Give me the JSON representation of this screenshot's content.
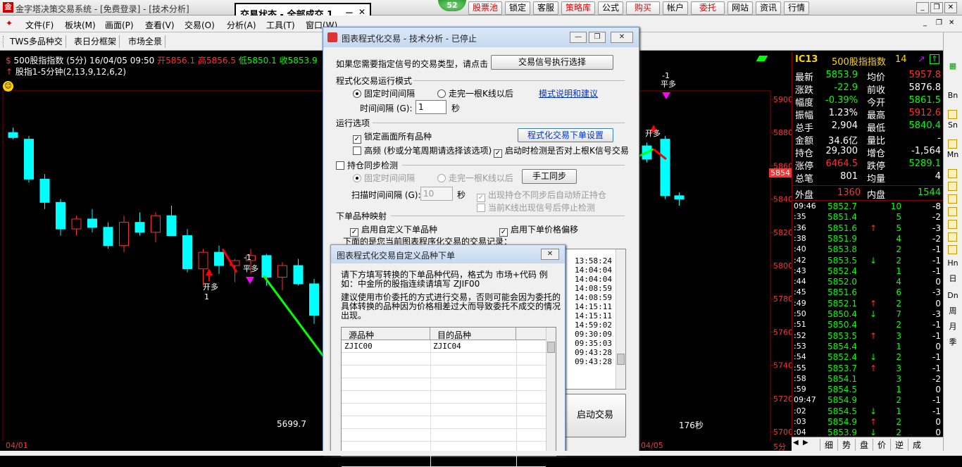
{
  "titlebar": {
    "title": "金字塔决策交易系统 - [免费登录] - [技术分析]",
    "badge": "52",
    "buttons": [
      {
        "label": "股票池",
        "red": true
      },
      {
        "label": "锁定",
        "red": false
      },
      {
        "label": "客服",
        "red": false
      },
      {
        "label": "策略库",
        "red": true
      },
      {
        "label": "公式",
        "red": false
      },
      {
        "label": "购买",
        "red": true
      },
      {
        "label": "帐户",
        "red": false
      },
      {
        "label": "委托",
        "red": true
      },
      {
        "label": "网站",
        "red": false
      },
      {
        "label": "资讯",
        "red": false
      },
      {
        "label": "行情",
        "red": false
      }
    ]
  },
  "trade_state": {
    "title": "交易状态 - 全部成交 1",
    "pin": "ᅳ",
    "close": "✕"
  },
  "menubar": {
    "items": [
      "文件(F)",
      "板块(M)",
      "画面(P)",
      "查看(V)",
      "交易(O)",
      "分析(A)",
      "工具(T)",
      "窗口(W)"
    ]
  },
  "toolbar": {
    "items": [
      "TWS多品种交",
      "表日分框架",
      "市场全景"
    ]
  },
  "chart": {
    "ticker_prefix": "500股指指数 (5分) 16/04/05 09:50",
    "open_label": "开5856.1",
    "high_label": "高5856.5",
    "low_label": "低5850.1",
    "close_label": "收5853.9",
    "indicator": "股指1-5分钟(2,13,9,12,6,2)",
    "y_ticks": [
      "5900",
      "5880",
      "5860",
      "5840",
      "5820",
      "5800",
      "5780",
      "5760",
      "5740",
      "5720",
      "5700"
    ],
    "current_price_tag": "5854",
    "low_annot": "5699.7",
    "x_left": "04/01",
    "x_right": "04/05",
    "timer": "176秒",
    "period": "5分",
    "signal_labels": [
      "开多",
      "开多",
      "平多",
      "-1",
      "1"
    ],
    "colors": {
      "up": "#ff3030",
      "down": "#00ffff",
      "signal_red": "#ff0000",
      "signal_green": "#00ff00",
      "magenta": "#ff00ff"
    }
  },
  "chart_data": {
    "type": "candlestick",
    "ylim": [
      5700,
      5900
    ],
    "candles": [
      {
        "o": 5880,
        "h": 5883,
        "l": 5876,
        "c": 5877
      },
      {
        "o": 5876,
        "h": 5878,
        "l": 5850,
        "c": 5852
      },
      {
        "o": 5852,
        "h": 5855,
        "l": 5834,
        "c": 5838
      },
      {
        "o": 5838,
        "h": 5840,
        "l": 5818,
        "c": 5822
      },
      {
        "o": 5822,
        "h": 5830,
        "l": 5818,
        "c": 5828
      },
      {
        "o": 5828,
        "h": 5834,
        "l": 5820,
        "c": 5823
      },
      {
        "o": 5823,
        "h": 5826,
        "l": 5810,
        "c": 5812
      },
      {
        "o": 5812,
        "h": 5830,
        "l": 5808,
        "c": 5826
      },
      {
        "o": 5826,
        "h": 5832,
        "l": 5818,
        "c": 5820
      },
      {
        "o": 5820,
        "h": 5832,
        "l": 5814,
        "c": 5830
      },
      {
        "o": 5830,
        "h": 5836,
        "l": 5818,
        "c": 5818
      },
      {
        "o": 5818,
        "h": 5822,
        "l": 5796,
        "c": 5798
      },
      {
        "o": 5798,
        "h": 5810,
        "l": 5788,
        "c": 5808
      },
      {
        "o": 5808,
        "h": 5812,
        "l": 5795,
        "c": 5800
      },
      {
        "o": 5800,
        "h": 5804,
        "l": 5790,
        "c": 5803
      },
      {
        "o": 5803,
        "h": 5810,
        "l": 5795,
        "c": 5806
      },
      {
        "o": 5806,
        "h": 5807,
        "l": 5788,
        "c": 5793
      },
      {
        "o": 5793,
        "h": 5802,
        "l": 5785,
        "c": 5800
      },
      {
        "o": 5800,
        "h": 5804,
        "l": 5788,
        "c": 5789
      },
      {
        "o": 5789,
        "h": 5792,
        "l": 5765,
        "c": 5770
      },
      {
        "o": 5770,
        "h": 5784,
        "l": 5760,
        "c": 5775
      },
      {
        "o": 5775,
        "h": 5780,
        "l": 5748,
        "c": 5750
      },
      {
        "o": 5750,
        "h": 5752,
        "l": 5712,
        "c": 5716
      },
      {
        "o": 5716,
        "h": 5738,
        "l": 5700,
        "c": 5734
      }
    ],
    "right_candles": [
      {
        "o": 5872,
        "h": 5874,
        "l": 5862,
        "c": 5864
      },
      {
        "o": 5876,
        "h": 5878,
        "l": 5840,
        "c": 5842
      },
      {
        "o": 5842,
        "h": 5844,
        "l": 5836,
        "c": 5840
      }
    ]
  },
  "quote": {
    "code": "IC13",
    "name": "500股指指数",
    "num": "14",
    "rows": [
      {
        "l1": "最新",
        "v1": "5853.9",
        "c1": "#00ff00",
        "l2": "均价",
        "v2": "5957.8",
        "c2": "#ff3030"
      },
      {
        "l1": "涨跌",
        "v1": "-22.9",
        "c1": "#00ff00",
        "l2": "前收",
        "v2": "5876.8",
        "c2": "#ffffff"
      },
      {
        "l1": "幅度",
        "v1": "-0.39%",
        "c1": "#00ff00",
        "l2": "今开",
        "v2": "5861.5",
        "c2": "#00ff00"
      },
      {
        "l1": "振幅",
        "v1": "1.23%",
        "c1": "#ffffff",
        "l2": "最高",
        "v2": "5912.6",
        "c2": "#ff3030"
      },
      {
        "l1": "总手",
        "v1": "2,904",
        "c1": "#ffffff",
        "l2": "最低",
        "v2": "5840.4",
        "c2": "#00ff00"
      },
      {
        "l1": "金额",
        "v1": "34.6亿",
        "c1": "#ffffff",
        "l2": "量比",
        "v2": "-",
        "c2": "#ffffff"
      },
      {
        "l1": "持仓",
        "v1": "29,300",
        "c1": "#ffffff",
        "l2": "增仓",
        "v2": "-1,564",
        "c2": "#ffffff"
      },
      {
        "l1": "涨停",
        "v1": "6464.5",
        "c1": "#ff3030",
        "l2": "跌停",
        "v2": "5289.1",
        "c2": "#00ff00"
      },
      {
        "l1": "总笔",
        "v1": "801",
        "c1": "#ffffff",
        "l2": "均量",
        "v2": "4",
        "c2": "#ffffff"
      }
    ],
    "outer_label": "外盘",
    "outer_value": "1360",
    "inner_label": "内盘",
    "inner_value": "1544",
    "ticks": [
      {
        "t": "09:46",
        "p": "5852.7",
        "a": "",
        "v": "10",
        "d": "-8"
      },
      {
        "t": ":35",
        "p": "5851.4",
        "a": "",
        "v": "5",
        "d": "-2"
      },
      {
        "t": ":36",
        "p": "5851.6",
        "a": "↑",
        "v": "5",
        "d": "-3"
      },
      {
        "t": ":38",
        "p": "5851.9",
        "a": "",
        "v": "4",
        "d": "-2"
      },
      {
        "t": ":40",
        "p": "5853.8",
        "a": "",
        "v": "2",
        "d": "-1"
      },
      {
        "t": ":42",
        "p": "5853.5",
        "a": "↓",
        "v": "2",
        "d": "-1"
      },
      {
        "t": ":43",
        "p": "5852.4",
        "a": "",
        "v": "1",
        "d": "-1"
      },
      {
        "t": ":44",
        "p": "5852.0",
        "a": "",
        "v": "4",
        "d": "0"
      },
      {
        "t": ":45",
        "p": "5851.6",
        "a": "",
        "v": "6",
        "d": "-3"
      },
      {
        "t": ":49",
        "p": "5852.1",
        "a": "↑",
        "v": "2",
        "d": "0"
      },
      {
        "t": ":50",
        "p": "5850.4",
        "a": "↓",
        "v": "7",
        "d": "-3"
      },
      {
        "t": ":51",
        "p": "5850.4",
        "a": "",
        "v": "2",
        "d": "-1"
      },
      {
        "t": ":52",
        "p": "5853.5",
        "a": "↑",
        "v": "3",
        "d": "-1"
      },
      {
        "t": ":53",
        "p": "5854.4",
        "a": "",
        "v": "1",
        "d": "0"
      },
      {
        "t": ":54",
        "p": "5852.4",
        "a": "↓",
        "v": "2",
        "d": "-1"
      },
      {
        "t": ":55",
        "p": "5853.7",
        "a": "↑",
        "v": "3",
        "d": "-1"
      },
      {
        "t": ":58",
        "p": "5854.1",
        "a": "",
        "v": "3",
        "d": "-2"
      },
      {
        "t": ":59",
        "p": "5854.5",
        "a": "",
        "v": "1",
        "d": "0"
      },
      {
        "t": "09:47",
        "p": "5854.9",
        "a": "",
        "v": "2",
        "d": "-1"
      },
      {
        "t": ":02",
        "p": "5854.5",
        "a": "↓",
        "v": "1",
        "d": "-1"
      },
      {
        "t": ":03",
        "p": "5854.9",
        "a": "↑",
        "v": "2",
        "d": "0"
      },
      {
        "t": ":04",
        "p": "5853.9",
        "a": "↓",
        "v": "2",
        "d": "0"
      }
    ],
    "tabs": [
      "细",
      "势",
      "盘",
      "价",
      "逆",
      "成"
    ]
  },
  "sidebar": {
    "items": [
      "Bn",
      "Sn",
      "Mn",
      "Hn",
      "日",
      "Dn",
      "周",
      "月",
      "季"
    ]
  },
  "dlg1": {
    "title": "图表程式化交易 - 技术分析 - 已停止",
    "intro": "如果您需要指定信号的交易类型，请点击",
    "intro_btn": "交易信号执行选择",
    "sec1": "程式化交易运行模式",
    "radio_fixed": "固定时间间隔",
    "radio_bar": "走完一根K线以后",
    "mode_link": "模式说明和建议",
    "interval_label": "时间间隔 (G):",
    "interval_value": "1",
    "interval_unit": "秒",
    "sec2": "运行选项",
    "chk_lock": "锁定画面所有品种",
    "order_settings_btn": "程式化交易下单设置",
    "chk_hf": "高频 (秒或分笔周期请选择该选项)",
    "chk_startup": "启动时检测是否对上根K信号交易",
    "chk_sync": "持仓同步检测",
    "sync_fixed": "固定时间间隔",
    "sync_bar": "走完一根K线以后",
    "manual_sync_btn": "手工同步",
    "scan_label": "扫描时间间隔 (G):",
    "scan_value": "10",
    "scan_unit": "秒",
    "chk_autofix": "出现持仓不同步后自动矫正持仓",
    "chk_stop": "当前K线出现信号后停止检测",
    "sec3": "下单品种映射",
    "chk_custom": "启用自定义下单品种",
    "chk_offset": "启用下单价格偏移",
    "record_label": "下面的是您当前图表程序化交易的交易记录：",
    "records": [
      "13:58:24",
      "14:04:04",
      "14:04:04",
      "14:08:59",
      "14:08:59",
      "14:15:11",
      "14:15:11",
      "14:59:02",
      "09:30:09",
      "09:35:03",
      "09:43:28",
      "09:43:28"
    ],
    "start_btn": "启动交易"
  },
  "dlg2": {
    "title": "图表程式化交易自定义品种下单",
    "desc1": "请下方填写转换的下单品种代码，格式为 市场+代码 例如：中金所的股指连续请填写 ZJIF00",
    "desc2": "建议使用市价委托的方式进行交易，否则可能会因为委托的具体转换的品种因为价格相差过大而导致委托不成交的情况出现。",
    "col_src": "源品种",
    "col_dst": "目的品种",
    "rows": [
      {
        "src": "ZJIC00",
        "dst": "ZJIC04"
      }
    ]
  }
}
